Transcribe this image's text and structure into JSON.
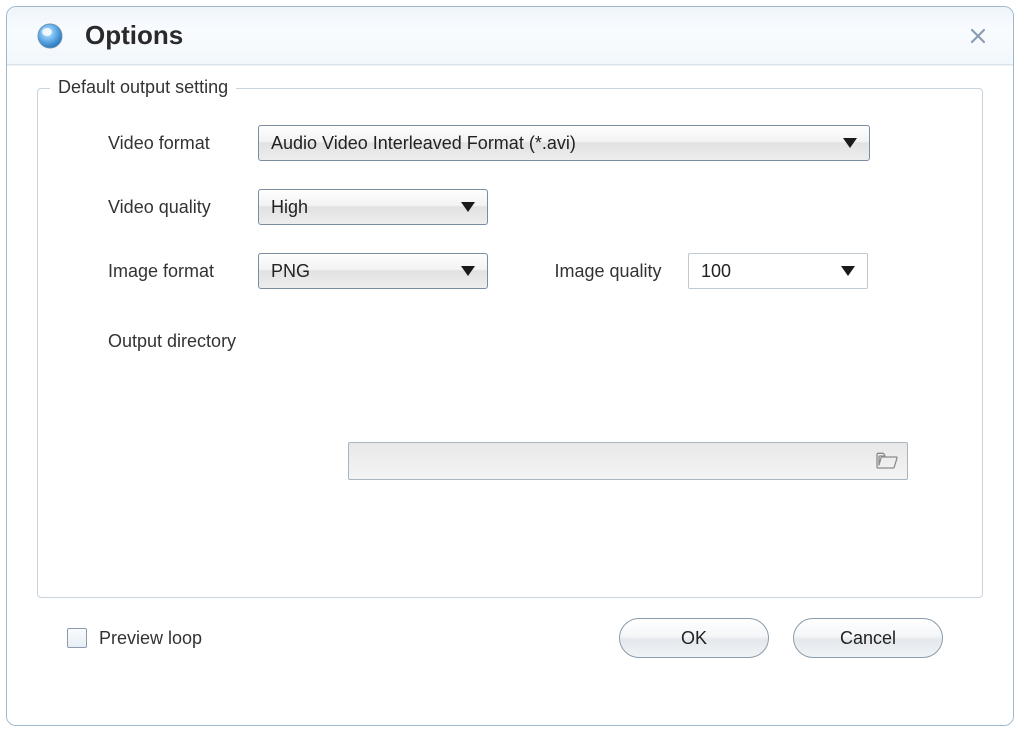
{
  "window": {
    "title": "Options"
  },
  "fieldset": {
    "legend": "Default output setting"
  },
  "labels": {
    "video_format": "Video format",
    "video_quality": "Video quality",
    "image_format": "Image format",
    "image_quality": "Image quality",
    "output_directory": "Output directory"
  },
  "values": {
    "video_format": "Audio Video Interleaved Format (*.avi)",
    "video_quality": "High",
    "image_format": "PNG",
    "image_quality": "100",
    "output_directory": ""
  },
  "footer": {
    "preview_loop": "Preview loop"
  },
  "buttons": {
    "ok": "OK",
    "cancel": "Cancel"
  }
}
